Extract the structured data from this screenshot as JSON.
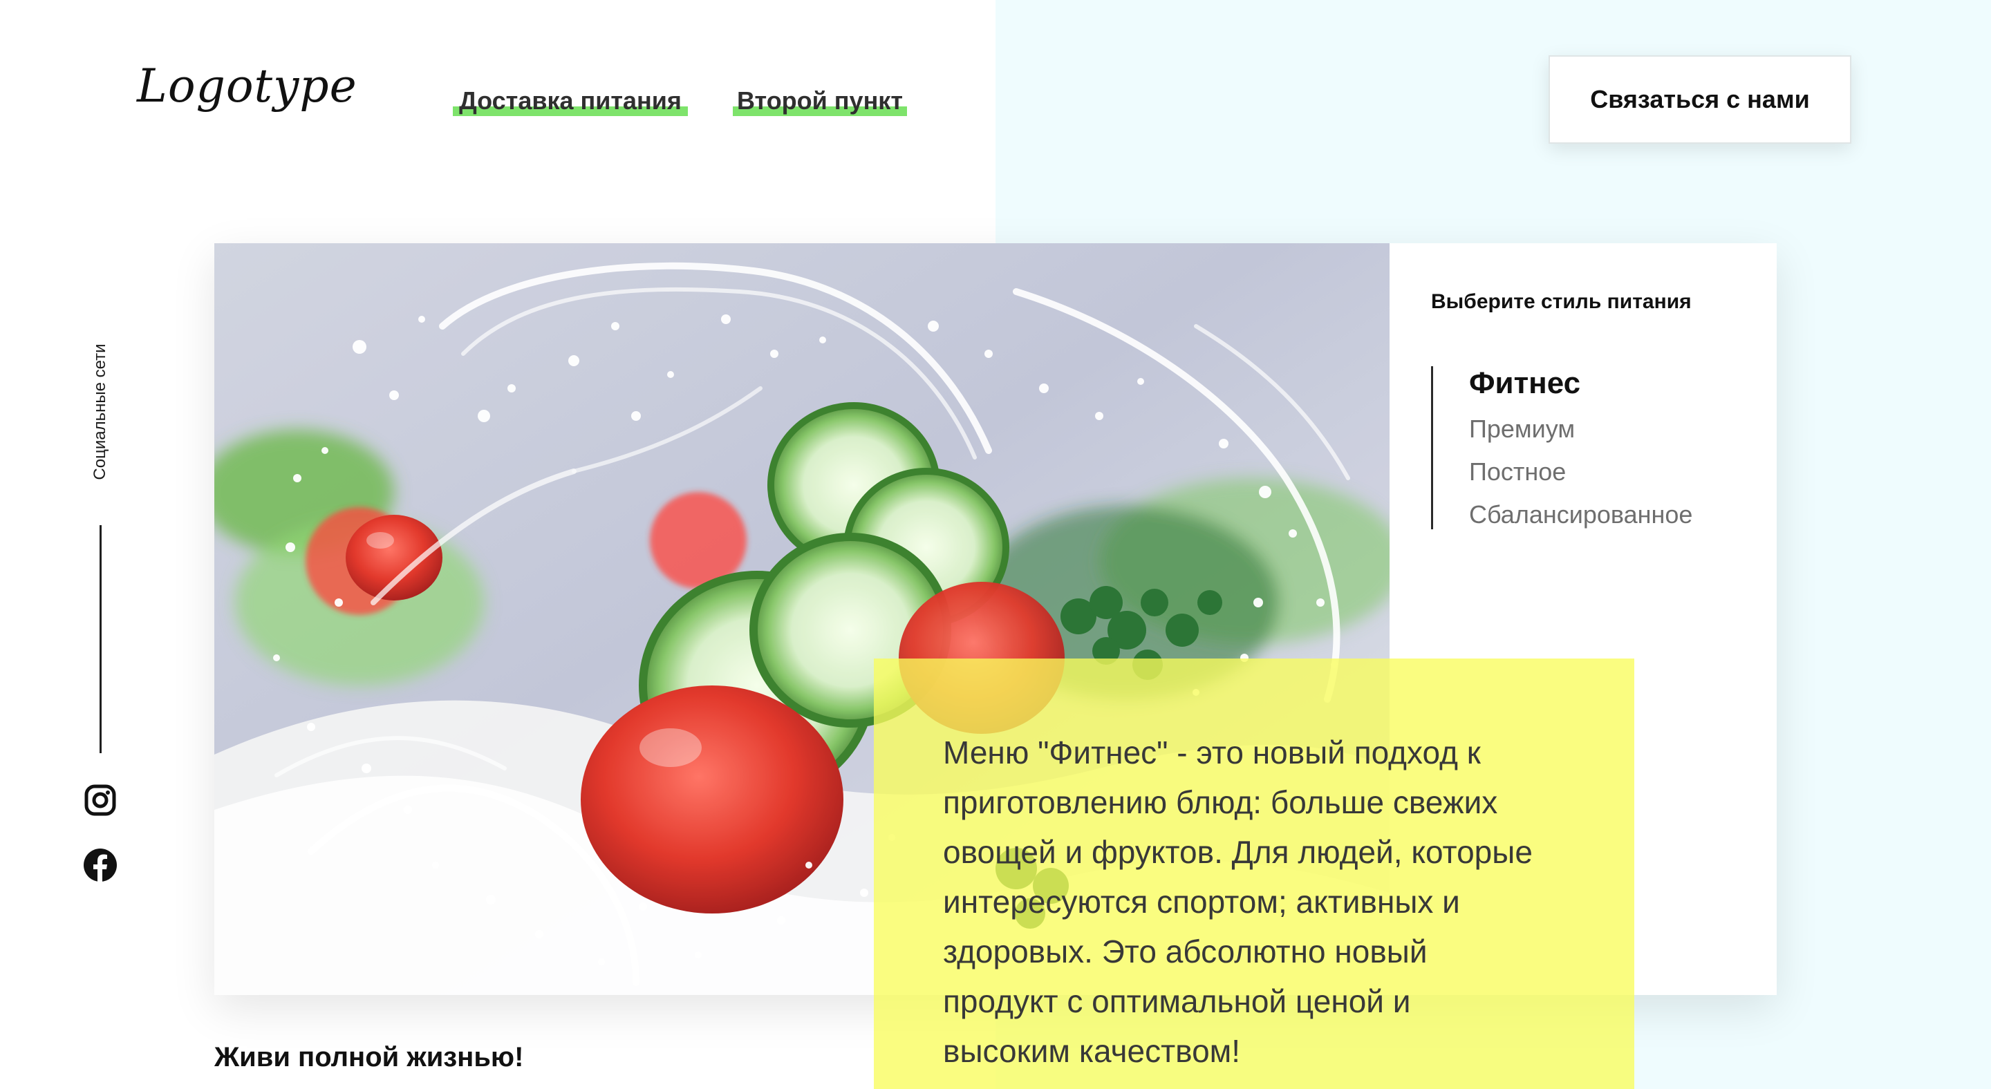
{
  "brand": {
    "logo_text": "Logotype"
  },
  "nav": {
    "items": [
      {
        "label": "Доставка питания"
      },
      {
        "label": "Второй пункт"
      }
    ]
  },
  "header": {
    "contact_button": "Связаться с нами"
  },
  "social": {
    "label": "Социальные сети",
    "icons": [
      "instagram-icon",
      "facebook-icon"
    ]
  },
  "panel": {
    "title": "Выберите стиль питания",
    "options": [
      {
        "label": "Фитнес",
        "active": true
      },
      {
        "label": "Премиум"
      },
      {
        "label": "Постное"
      },
      {
        "label": "Сбалансированное"
      }
    ]
  },
  "description": {
    "text": "Меню \"Фитнес\" - это новый подход к\nприготовлению блюд: больше свежих\nовощей и фруктов. Для людей, которые\nинтересуются спортом; активных и\nздоровых. Это абсолютно новый\nпродукт с оптимальной ценой и\nвысоким качеством!"
  },
  "footer": {
    "headline": "Живи полной жизнью!"
  },
  "colors": {
    "accent_green": "#7ee36b",
    "info_yellow": "#f9fc5c",
    "bg_right": "#effcfe"
  }
}
